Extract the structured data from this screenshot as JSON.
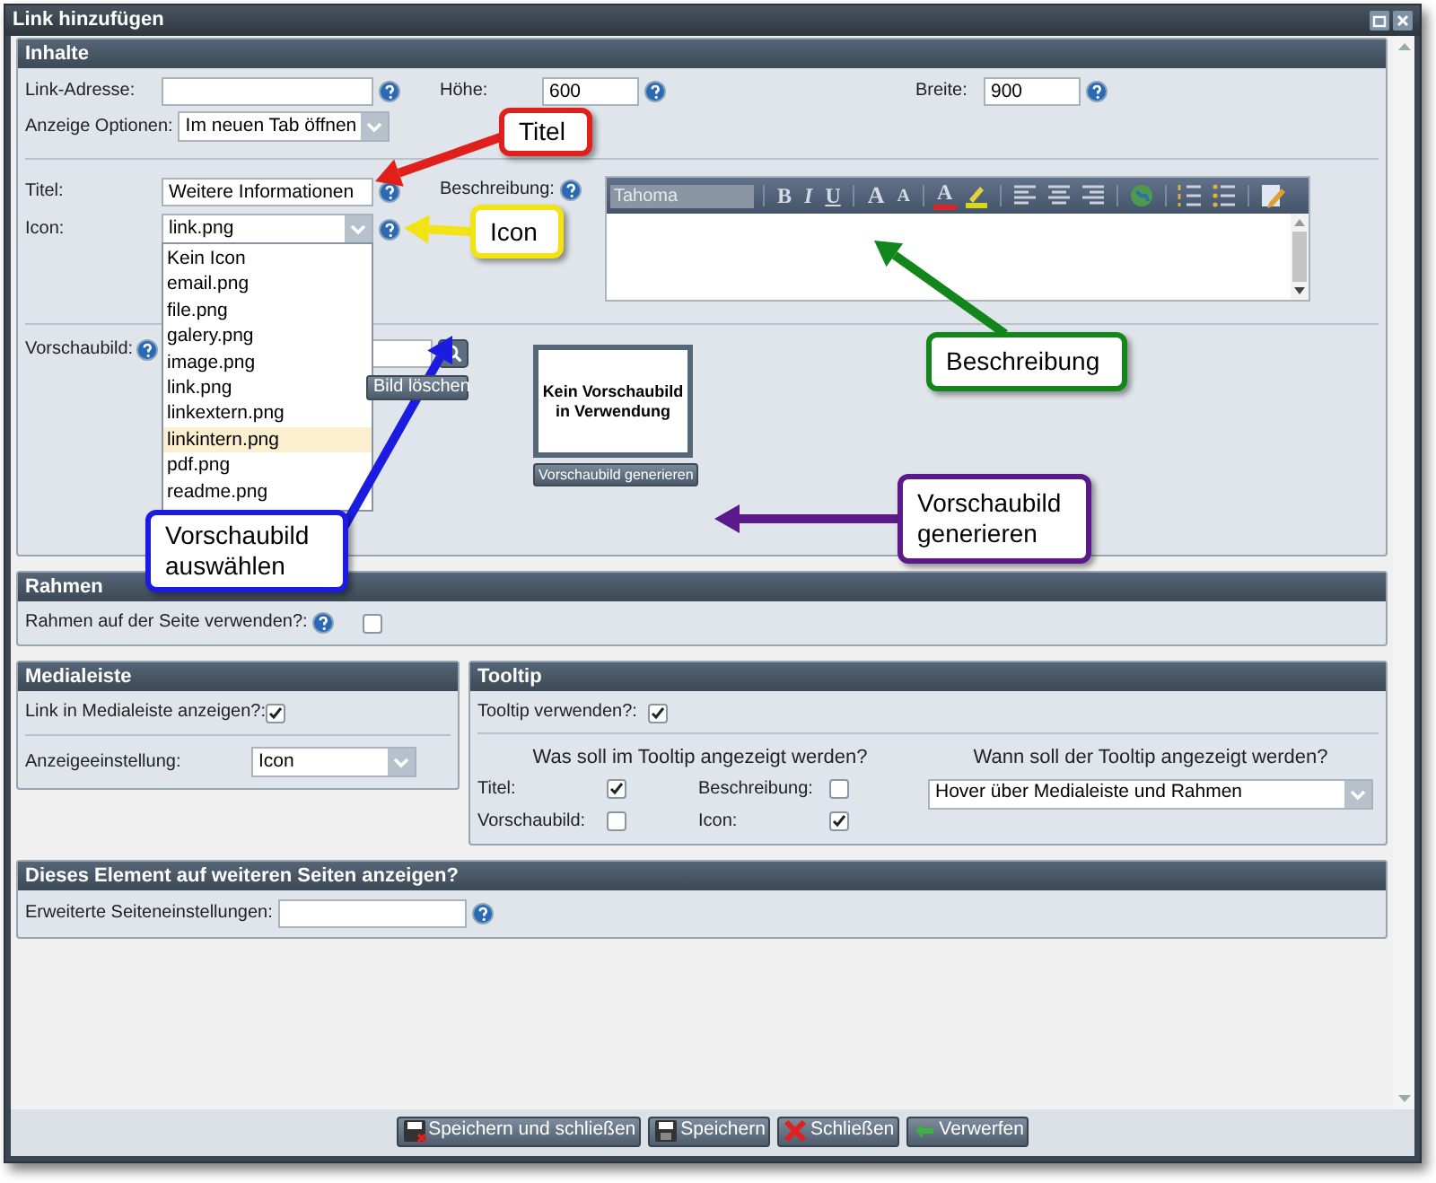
{
  "window": {
    "title": "Link hinzufügen"
  },
  "content": {
    "title": "Inhalte",
    "link_address": {
      "label": "Link-Adresse:"
    },
    "height": {
      "label": "Höhe:",
      "value": "600"
    },
    "width": {
      "label": "Breite:",
      "value": "900"
    },
    "display_options": {
      "label": "Anzeige Optionen:",
      "value": "Im neuen Tab öffnen"
    },
    "title_field": {
      "label": "Titel:",
      "value": "Weitere Informationen"
    },
    "icon": {
      "label": "Icon:",
      "value": "link.png",
      "expanded": true,
      "options": [
        {
          "label": "Kein Icon",
          "highlighted": false
        },
        {
          "label": "email.png",
          "highlighted": false
        },
        {
          "label": "file.png",
          "highlighted": false
        },
        {
          "label": "galery.png",
          "highlighted": false
        },
        {
          "label": "image.png",
          "highlighted": false
        },
        {
          "label": "link.png",
          "highlighted": false
        },
        {
          "label": "linkextern.png",
          "highlighted": false
        },
        {
          "label": "linkintern.png",
          "highlighted": true
        },
        {
          "label": "pdf.png",
          "highlighted": false
        },
        {
          "label": "readme.png",
          "highlighted": false
        }
      ]
    },
    "description": {
      "label": "Beschreibung:",
      "font": {
        "value": "Tahoma",
        "disabled": true
      },
      "toolbar": [
        [
          {
            "kind": "bold",
            "label": "B"
          },
          {
            "kind": "italic",
            "label": "I"
          },
          {
            "kind": "underline",
            "label": "U"
          }
        ],
        [
          {
            "kind": "grow",
            "label": "A"
          },
          {
            "kind": "shrink",
            "label": "A"
          }
        ],
        [
          {
            "kind": "forecolor",
            "label": "A"
          },
          {
            "kind": "highlight"
          }
        ],
        [
          {
            "kind": "align-left"
          },
          {
            "kind": "align-center"
          },
          {
            "kind": "align-right"
          }
        ],
        [
          {
            "kind": "link"
          }
        ],
        [
          {
            "kind": "ordered-list"
          },
          {
            "kind": "bullet-list"
          }
        ],
        [
          {
            "kind": "source"
          }
        ]
      ]
    },
    "preview": {
      "label": "Vorschaubild:",
      "delete_button": "Bild löschen",
      "empty_text": "Kein Vorschaubild in Verwendung",
      "generate_button": "Vorschaubild generieren"
    }
  },
  "frame": {
    "title": "Rahmen",
    "use_frame": {
      "label": "Rahmen auf der Seite verwenden?:",
      "checked": false
    }
  },
  "media_bar": {
    "title": "Medialeiste",
    "show_link": {
      "label": "Link in Medialeiste anzeigen?:",
      "checked": true
    },
    "display_setting": {
      "label": "Anzeigeeinstellung:",
      "value": "Icon"
    }
  },
  "tooltip": {
    "title": "Tooltip",
    "use_tooltip": {
      "label": "Tooltip verwenden?:",
      "checked": true
    },
    "what_heading": "Was soll im Tooltip angezeigt werden?",
    "items": [
      {
        "label": "Titel:",
        "checked": true
      },
      {
        "label": "Beschreibung:",
        "checked": false
      },
      {
        "label": "Vorschaubild:",
        "checked": false
      },
      {
        "label": "Icon:",
        "checked": true
      }
    ],
    "when_heading": "Wann soll der Tooltip angezeigt werden?",
    "when": {
      "value": "Hover über Medialeiste und Rahmen"
    }
  },
  "other_pages": {
    "title": "Dieses Element auf weiteren Seiten anzeigen?",
    "advanced": {
      "label": "Erweiterte Seiteneinstellungen:"
    }
  },
  "footer_buttons": [
    {
      "kind": "save-close",
      "label": "Speichern und schließen"
    },
    {
      "kind": "save",
      "label": "Speichern"
    },
    {
      "kind": "close",
      "label": "Schließen"
    },
    {
      "kind": "discard",
      "label": "Verwerfen"
    }
  ],
  "callouts": [
    {
      "text": "Titel",
      "color": "#e0201b"
    },
    {
      "text": "Icon",
      "color": "#f2e414"
    },
    {
      "text": "Beschreibung",
      "color": "#12861a"
    },
    {
      "text": "Vorschaubild auswählen",
      "color": "#1c1ce0"
    },
    {
      "text": "Vorschaubild generieren",
      "color": "#5a1a8c"
    }
  ]
}
